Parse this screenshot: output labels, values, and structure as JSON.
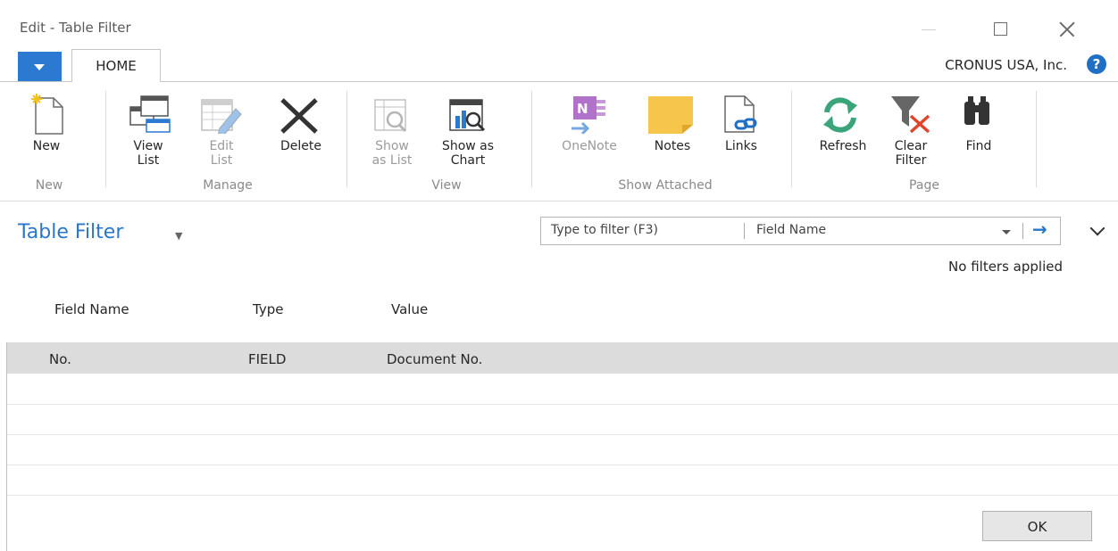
{
  "window": {
    "title": "Edit - Table Filter"
  },
  "ribbon": {
    "tab_label": "HOME",
    "company": "CRONUS USA, Inc.",
    "help_glyph": "?",
    "groups": {
      "new": "New",
      "manage": "Manage",
      "view": "View",
      "show_attached": "Show Attached",
      "page": "Page"
    },
    "buttons": {
      "new": "New",
      "view_list": "View\nList",
      "edit_list": "Edit\nList",
      "delete": "Delete",
      "show_as_list": "Show\nas List",
      "show_as_chart": "Show as\nChart",
      "onenote": "OneNote",
      "notes": "Notes",
      "links": "Links",
      "refresh": "Refresh",
      "clear_filter": "Clear\nFilter",
      "find": "Find"
    },
    "icons": [
      "new-icon",
      "view-list-icon",
      "edit-list-icon",
      "delete-icon",
      "show-as-list-icon",
      "show-as-chart-icon",
      "onenote-icon",
      "notes-icon",
      "links-icon",
      "refresh-icon",
      "clear-filter-icon",
      "find-icon"
    ]
  },
  "page": {
    "title": "Table Filter",
    "filter_placeholder": "Type to filter (F3)",
    "filter_field": "Field Name",
    "no_filters": "No filters applied"
  },
  "table": {
    "columns": [
      "Field Name",
      "Type",
      "Value"
    ],
    "rows": [
      {
        "field_name": "No.",
        "type": "FIELD",
        "value": "Document No."
      }
    ]
  },
  "footer": {
    "ok_label": "OK"
  },
  "colors": {
    "accent": "#2b79d0",
    "title_blue": "#2a77c9",
    "selected_row": "#dcdcdc"
  }
}
